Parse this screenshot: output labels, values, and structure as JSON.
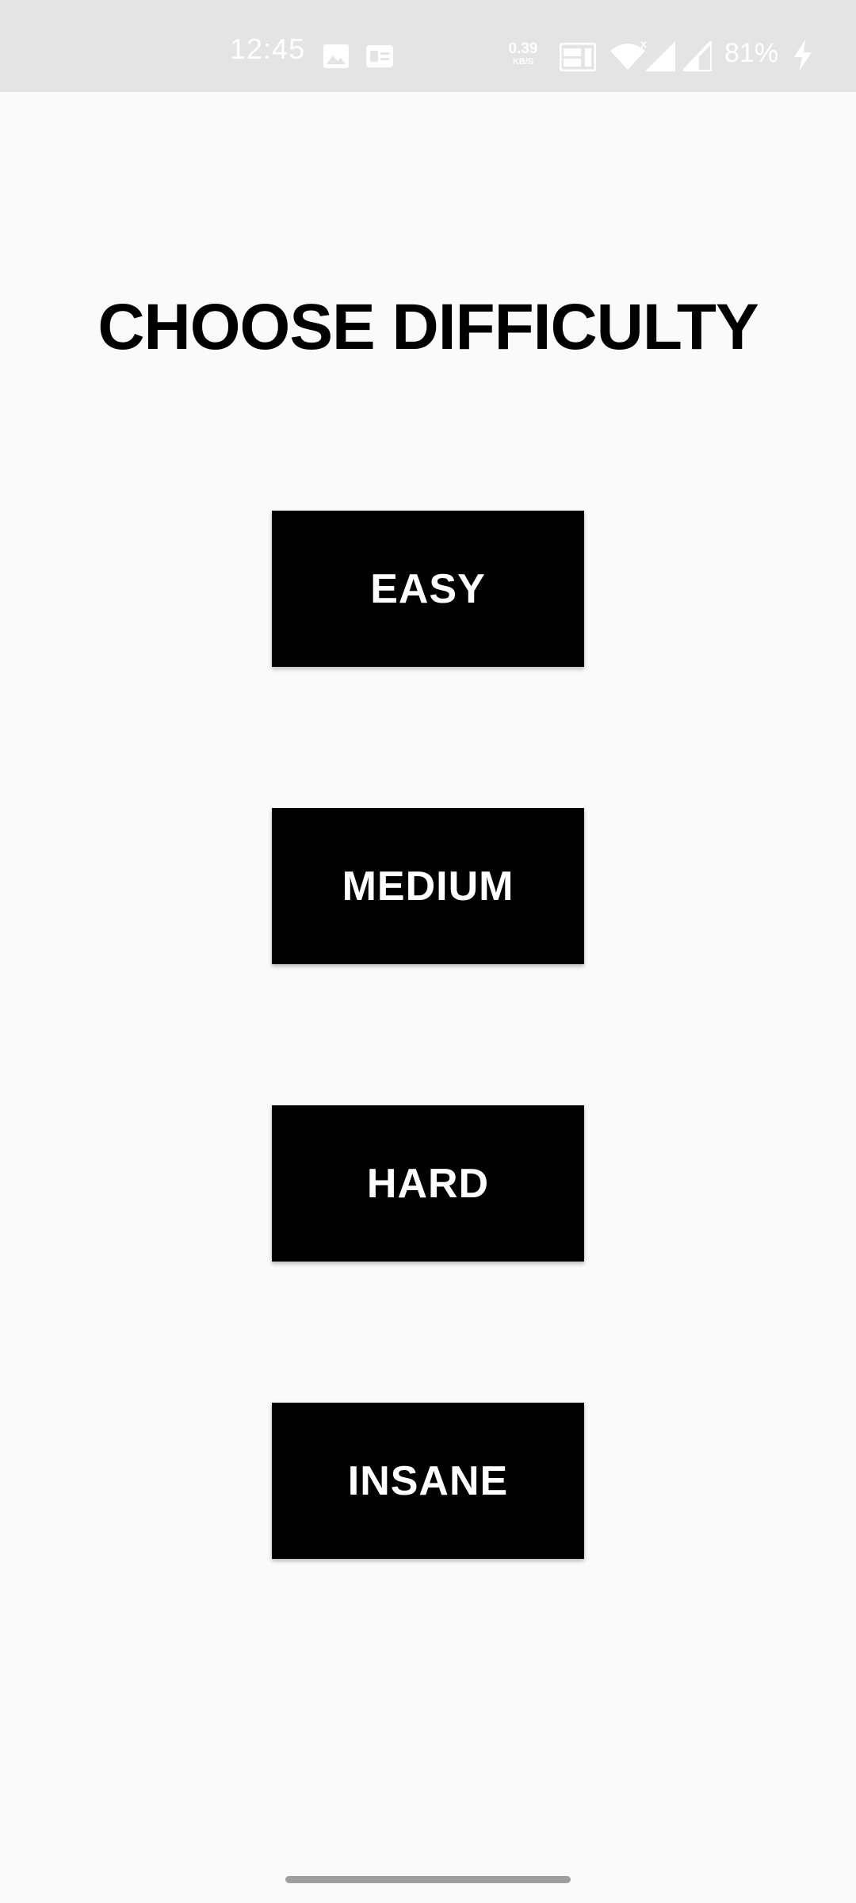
{
  "status_bar": {
    "time": "12:45",
    "net_speed_value": "0.39",
    "net_speed_unit": "KB/S",
    "battery_percent": "81%",
    "icons": [
      "image-icon",
      "sim-card-icon",
      "volte-icon",
      "wifi-icon",
      "signal-icon",
      "signal-icon",
      "charging-icon"
    ]
  },
  "screen": {
    "title": "CHOOSE DIFFICULTY",
    "buttons": {
      "easy": "EASY",
      "medium": "MEDIUM",
      "hard": "HARD",
      "insane": "INSANE"
    }
  },
  "colors": {
    "background": "#fafafa",
    "status_bar": "#e4e4e4",
    "button_bg": "#000000",
    "button_text": "#ffffff",
    "title_text": "#000000"
  }
}
